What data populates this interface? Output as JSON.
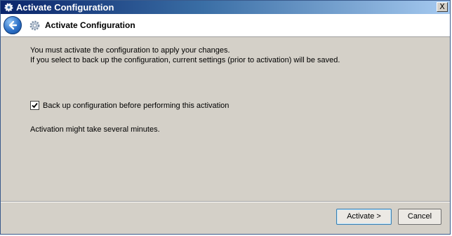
{
  "window": {
    "title": "Activate Configuration",
    "close_label": "X"
  },
  "header": {
    "title": "Activate Configuration"
  },
  "content": {
    "message_line1": "You must activate the configuration to apply your changes.",
    "message_line2": "If you select to back up the configuration, current settings (prior to activation) will be saved.",
    "backup_checkbox": {
      "label": "Back up configuration before performing this activation",
      "checked": true
    },
    "note": "Activation might take several minutes."
  },
  "buttons": {
    "activate_label": "Activate >",
    "cancel_label": "Cancel"
  },
  "colors": {
    "titlebar_start": "#0a246a",
    "titlebar_end": "#a6caf0",
    "dialog_background": "#d4d0c8",
    "header_background": "#ffffff",
    "back_button": "#2f72c8"
  },
  "icons": {
    "title": "gear-icon",
    "back": "back-arrow-icon",
    "header": "gear-icon",
    "checkbox": "checkmark-icon"
  }
}
